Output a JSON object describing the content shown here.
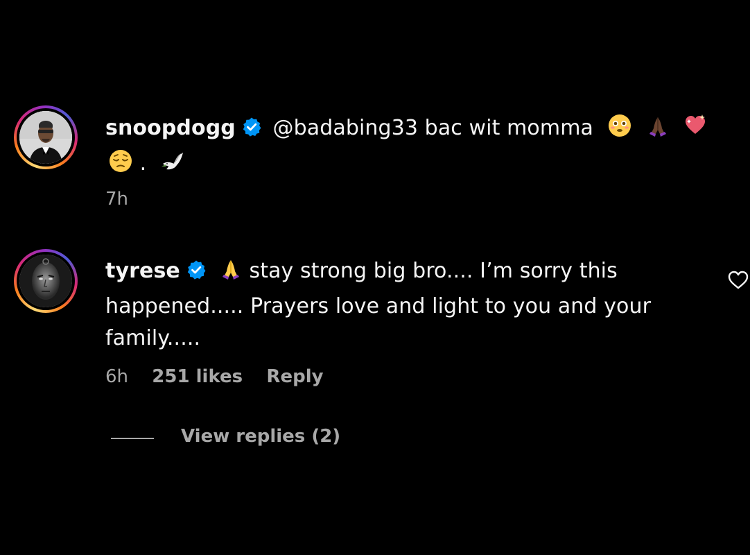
{
  "comments": [
    {
      "username": "snoopdogg",
      "text_line1": "@badabing33 bac wit momma",
      "text_line2": ".",
      "emojis_line1": [
        "flushed-face",
        "folded-hands",
        "sparkling-heart"
      ],
      "emojis_line2_before": "pensive-face",
      "emojis_line2_after": "dove",
      "time": "7h"
    },
    {
      "username": "tyrese",
      "text_line1": "stay strong big bro.... I’m sorry this",
      "text_line2": "happened..... Prayers love and light to you and your",
      "text_line3": "family.....",
      "emoji_lead": "folded-hands",
      "time": "6h",
      "likes": "251 likes",
      "reply": "Reply",
      "view_replies": "View replies (2)"
    }
  ],
  "colors": {
    "background": "#000000",
    "text": "#f5f5f5",
    "muted": "#a8a8a8",
    "verified": "#0095f6"
  }
}
